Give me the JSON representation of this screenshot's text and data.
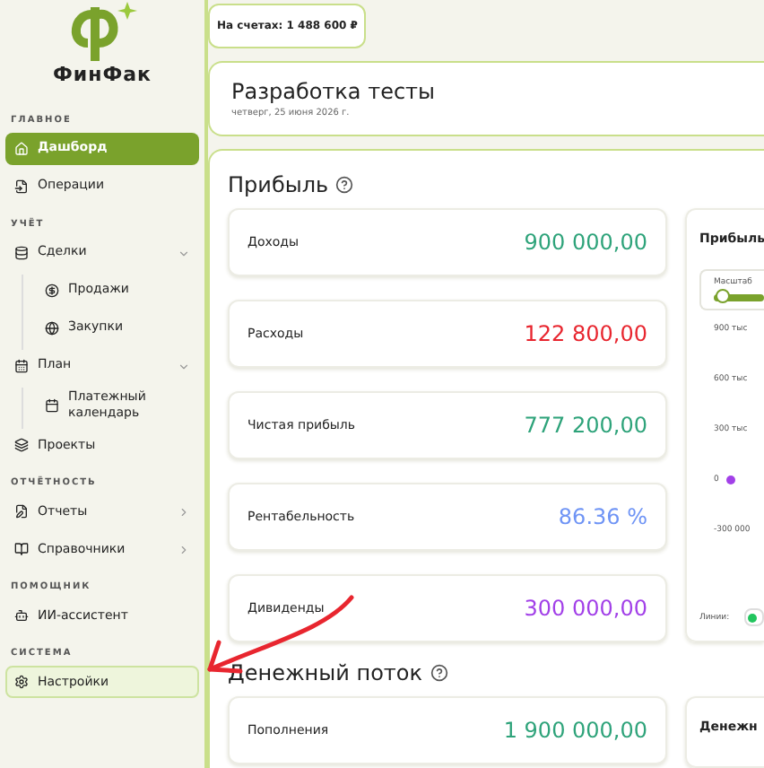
{
  "brand": {
    "name": "ФинФак"
  },
  "sidebar": {
    "sections": [
      {
        "label": "ГЛАВНОЕ",
        "items": [
          {
            "kind": "home",
            "label": "Дашборд",
            "selected": true,
            "highlighted": false
          },
          {
            "kind": "operations",
            "label": "Операции",
            "selected": false,
            "highlighted": false
          }
        ]
      },
      {
        "label": "УЧЁТ",
        "items": [
          {
            "kind": "deals",
            "label": "Сделки",
            "selected": false,
            "highlighted": false,
            "expanded": true,
            "children": [
              {
                "kind": "sales",
                "label": "Продажи",
                "selected": false,
                "highlighted": false
              },
              {
                "kind": "purchases",
                "label": "Закупки",
                "selected": false,
                "highlighted": false
              }
            ]
          },
          {
            "kind": "plan",
            "label": "План",
            "selected": false,
            "highlighted": false,
            "expanded": true,
            "children": [
              {
                "kind": "calendar",
                "label": "Платежный календарь",
                "selected": false,
                "highlighted": false
              }
            ]
          },
          {
            "kind": "projects",
            "label": "Проекты",
            "selected": false,
            "highlighted": false
          }
        ]
      },
      {
        "label": "ОТЧЁТНОСТЬ",
        "items": [
          {
            "kind": "reports",
            "label": "Отчеты",
            "selected": false,
            "highlighted": false,
            "expanded": false
          },
          {
            "kind": "references",
            "label": "Справочники",
            "selected": false,
            "highlighted": false,
            "expanded": false
          }
        ]
      },
      {
        "label": "ПОМОЩНИК",
        "items": [
          {
            "kind": "assistant",
            "label": "ИИ-ассистент",
            "selected": false,
            "highlighted": false
          }
        ]
      },
      {
        "label": "СИСТЕМА",
        "items": [
          {
            "kind": "settings",
            "label": "Настройки",
            "selected": false,
            "highlighted": true
          }
        ]
      }
    ]
  },
  "balance": "На счетах: 1 488 600 ₽",
  "header": {
    "title": "Разработка тесты",
    "date": "четверг, 25 июня 2026 г."
  },
  "profit": {
    "title": "Прибыль",
    "metrics": [
      {
        "label": "Доходы",
        "value": "900 000,00",
        "color": "#2ea37a"
      },
      {
        "label": "Расходы",
        "value": "122 800,00",
        "color": "#e8262f"
      },
      {
        "label": "Чистая прибыль",
        "value": "777 200,00",
        "color": "#2ea37a"
      },
      {
        "label": "Рентабельность",
        "value": "86.36 %",
        "color": "#6f94f5"
      },
      {
        "label": "Дивиденды",
        "value": "300 000,00",
        "color": "#a240e8"
      }
    ],
    "chart_panel": {
      "title": "Прибыль",
      "scale_label": "Масштаб",
      "scale": {
        "level": 0.05
      },
      "y_ticks": [
        "900 тыс",
        "600 тыс",
        "300 тыс",
        "0",
        "-300 000"
      ],
      "legend": [
        {
          "color": "#a240e8"
        }
      ],
      "lines_label": "Линии:",
      "lines_on": true
    }
  },
  "cashflow": {
    "title": "Денежный поток",
    "metrics": [
      {
        "label": "Пополнения",
        "value": "1 900 000,00",
        "color": "#2ea37a"
      }
    ],
    "panel_title": "Денежн"
  }
}
